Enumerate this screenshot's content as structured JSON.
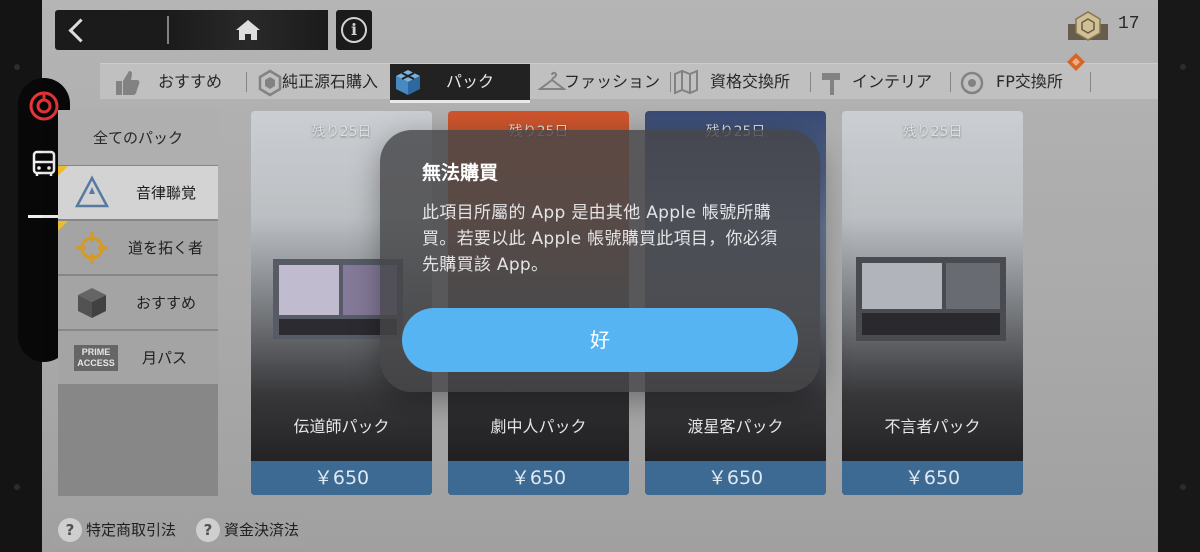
{
  "top_bar": {
    "info_glyph": "i",
    "currency_count": "17"
  },
  "tabs": [
    {
      "label": "おすすめ",
      "icon": "thumbs-up-icon",
      "active": false
    },
    {
      "label": "純正源石購入",
      "icon": "originium-icon",
      "active": false
    },
    {
      "label": "パック",
      "icon": "cube-pack-icon",
      "active": true
    },
    {
      "label": "ファッション",
      "icon": "hanger-icon",
      "active": false
    },
    {
      "label": "資格交換所",
      "icon": "map-icon",
      "active": false
    },
    {
      "label": "インテリア",
      "icon": "hammer-icon",
      "active": false
    },
    {
      "label": "FP交換所",
      "icon": "fp-coin-icon",
      "active": false
    }
  ],
  "side_menu": {
    "all_label": "全てのパック",
    "items": [
      {
        "label": "音律聯覚",
        "icon": "triangle-star-icon",
        "active": true
      },
      {
        "label": "道を拓く者",
        "icon": "crosshair-icon",
        "active": false
      },
      {
        "label": "おすすめ",
        "icon": "cube-icon",
        "active": false
      },
      {
        "label": "月パス",
        "icon": "prime-access-icon",
        "active": false,
        "badge": "PRIME ACCESS"
      }
    ]
  },
  "cards": [
    {
      "timer": "残り25日",
      "name": "伝道師パック",
      "price": "￥650"
    },
    {
      "timer": "残り25日",
      "name": "劇中人パック",
      "price": "￥650"
    },
    {
      "timer": "残り25日",
      "name": "渡星客パック",
      "price": "￥650"
    },
    {
      "timer": "残り25日",
      "name": "不言者パック",
      "price": "￥650"
    }
  ],
  "footer": {
    "buttons": [
      {
        "label": "特定商取引法",
        "icon": "question-icon"
      },
      {
        "label": "資金決済法",
        "icon": "question-icon"
      }
    ],
    "question_glyph": "?"
  },
  "alert": {
    "title": "無法購買",
    "message": "此項目所屬的 App 是由其他 Apple 帳號所購買。若要以此 Apple 帳號購買此項目，你必須先購買該 App。",
    "ok_label": "好"
  },
  "colors": {
    "price_bar": "#3f6f99",
    "alert_button": "#57b4f3",
    "active_tab": "#242424",
    "fp_marker": "#e06a2a"
  }
}
